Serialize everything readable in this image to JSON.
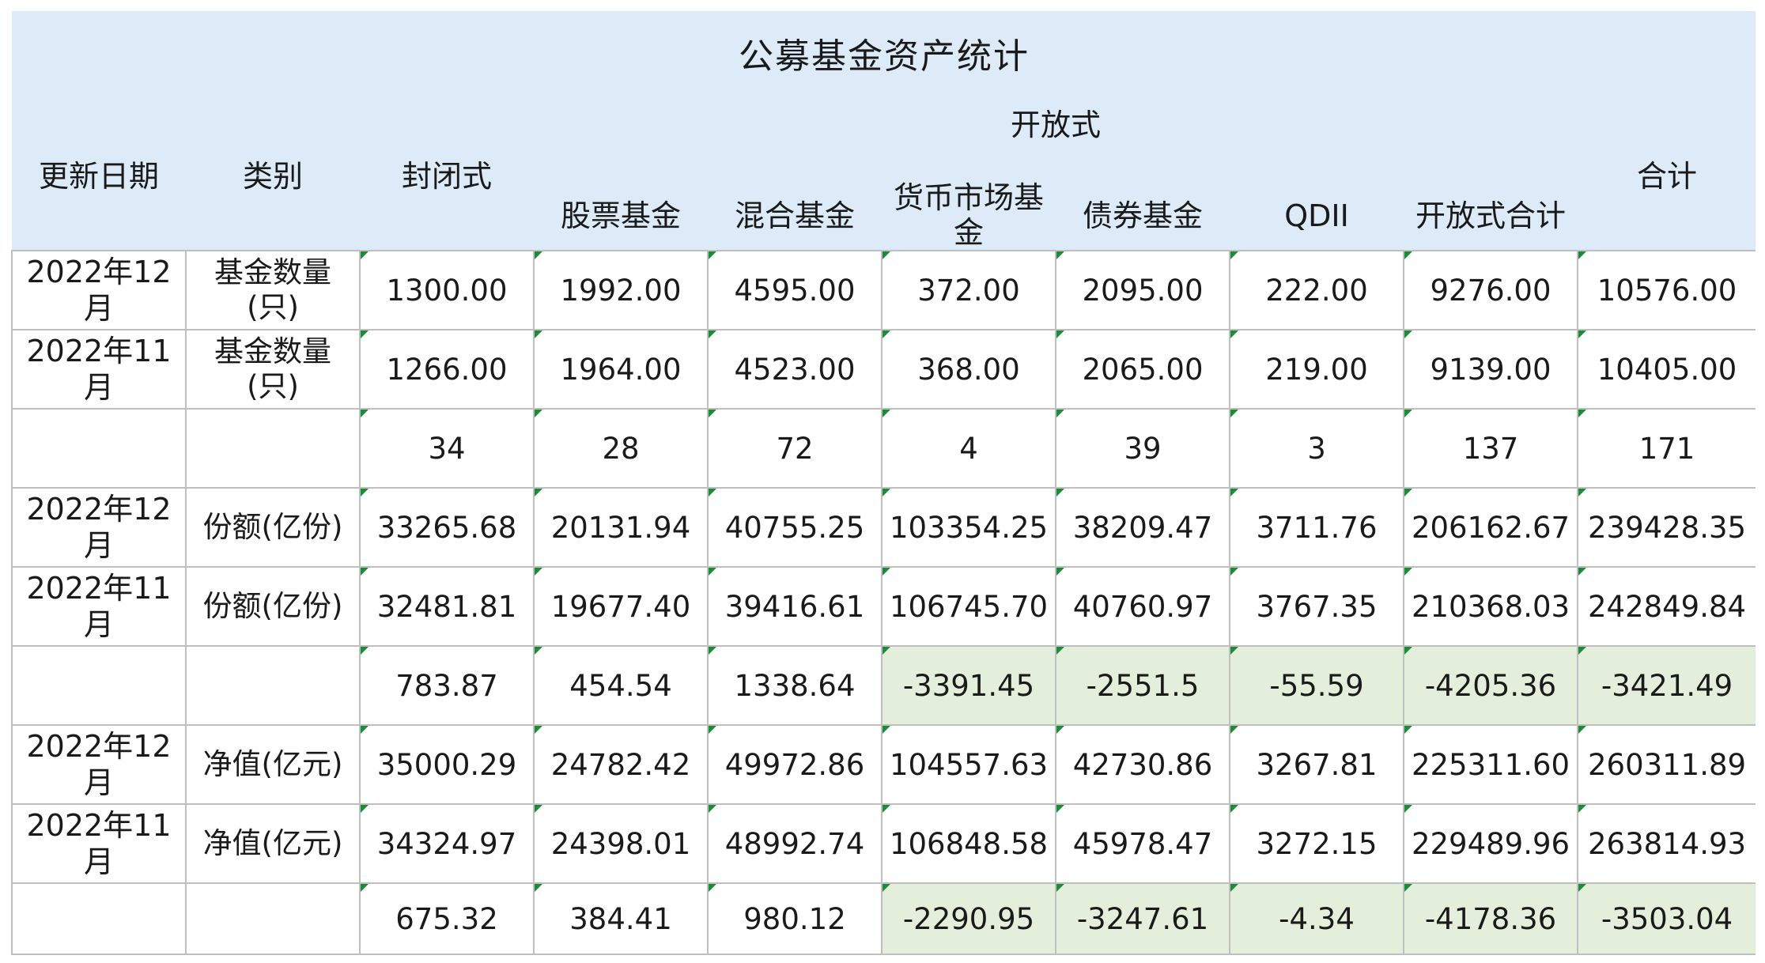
{
  "title": "公募基金资产统计",
  "headers": {
    "date": "更新日期",
    "category": "类别",
    "closed": "封闭式",
    "open": "开放式",
    "total": "合计",
    "open_sub": [
      "股票基金",
      "混合基金",
      "货币市场基金",
      "债券基金",
      "QDII",
      "开放式合计"
    ]
  },
  "rows": [
    {
      "date": "2022年12月",
      "category": "基金数量(只)",
      "values": [
        "1300.00",
        "1992.00",
        "4595.00",
        "372.00",
        "2095.00",
        "222.00",
        "9276.00",
        "10576.00"
      ]
    },
    {
      "date": "2022年11月",
      "category": "基金数量(只)",
      "values": [
        "1266.00",
        "1964.00",
        "4523.00",
        "368.00",
        "2065.00",
        "219.00",
        "9139.00",
        "10405.00"
      ]
    },
    {
      "date": "",
      "category": "",
      "values": [
        "34",
        "28",
        "72",
        "4",
        "39",
        "3",
        "137",
        "171"
      ]
    },
    {
      "date": "2022年12月",
      "category": "份额(亿份)",
      "values": [
        "33265.68",
        "20131.94",
        "40755.25",
        "103354.25",
        "38209.47",
        "3711.76",
        "206162.67",
        "239428.35"
      ]
    },
    {
      "date": "2022年11月",
      "category": "份额(亿份)",
      "values": [
        "32481.81",
        "19677.40",
        "39416.61",
        "106745.70",
        "40760.97",
        "3767.35",
        "210368.03",
        "242849.84"
      ]
    },
    {
      "date": "",
      "category": "",
      "values": [
        "783.87",
        "454.54",
        "1338.64",
        "-3391.45",
        "-2551.5",
        "-55.59",
        "-4205.36",
        "-3421.49"
      ]
    },
    {
      "date": "2022年12月",
      "category": "净值(亿元)",
      "values": [
        "35000.29",
        "24782.42",
        "49972.86",
        "104557.63",
        "42730.86",
        "3267.81",
        "225311.60",
        "260311.89"
      ]
    },
    {
      "date": "2022年11月",
      "category": "净值(亿元)",
      "values": [
        "34324.97",
        "24398.01",
        "48992.74",
        "106848.58",
        "45978.47",
        "3272.15",
        "229489.96",
        "263814.93"
      ]
    },
    {
      "date": "",
      "category": "",
      "values": [
        "675.32",
        "384.41",
        "980.12",
        "-2290.95",
        "-3247.61",
        "-4.34",
        "-4178.36",
        "-3503.04"
      ]
    }
  ],
  "colors": {
    "header_bg": "#dcebf7",
    "negative_bg": "#e3efda",
    "grid_line": "#bfbfbf",
    "corner_marker": "#1e8a3a"
  }
}
